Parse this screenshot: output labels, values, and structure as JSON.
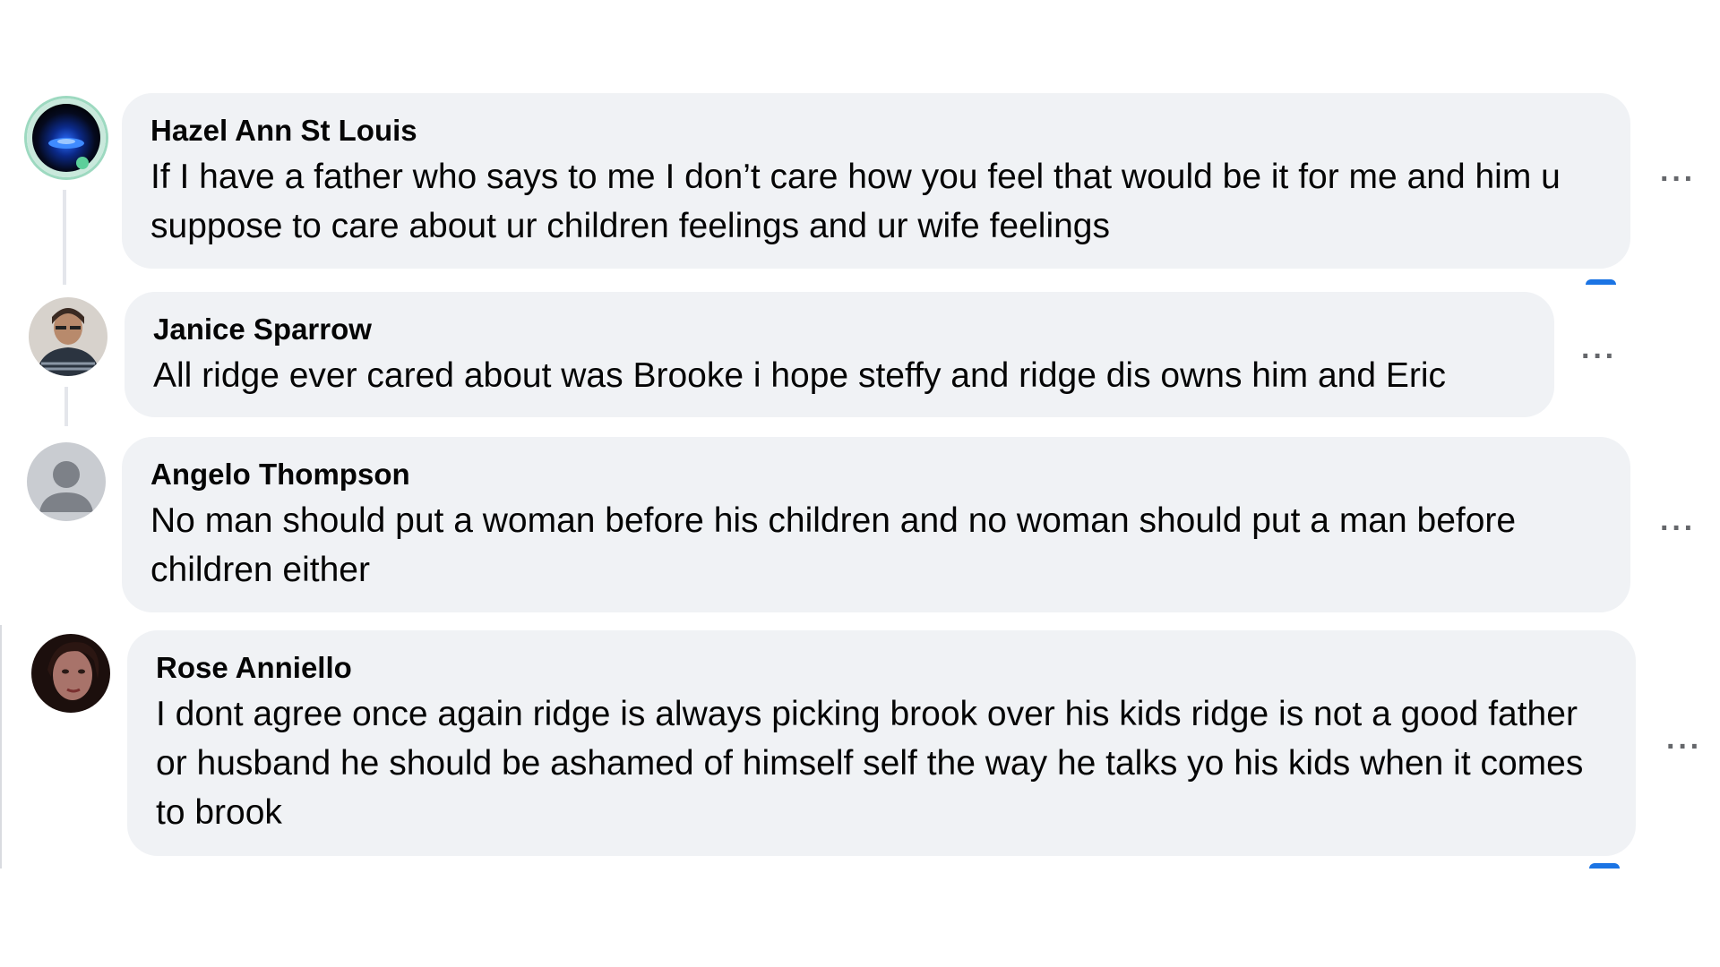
{
  "comments": [
    {
      "author": "Hazel Ann St Louis",
      "text": "If I have a father who says to me I don’t care how you feel that would be it for me and him u suppose to care about ur children feelings and ur wife feelings",
      "avatar_icon": "avatar-hazel",
      "more_label": "···"
    },
    {
      "author": "Janice Sparrow",
      "text": "All ridge ever cared about was Brooke i hope steffy and ridge dis owns him and Eric",
      "avatar_icon": "avatar-janice",
      "more_label": "···"
    },
    {
      "author": "Angelo Thompson",
      "text": "No man should put a woman before his children and no woman should put a man before children either",
      "avatar_icon": "default-user-avatar-icon",
      "more_label": "···"
    },
    {
      "author": "Rose Anniello",
      "text": "I dont agree once again ridge is always picking brook over his kids ridge is not a good father or husband he should be ashamed of himself self the way he talks yo his kids when it comes to brook",
      "avatar_icon": "avatar-rose",
      "more_label": "···"
    }
  ],
  "colors": {
    "bubble": "#f0f2f5",
    "text": "#050505",
    "secondary": "#65676b",
    "accent": "#1b74e4"
  }
}
